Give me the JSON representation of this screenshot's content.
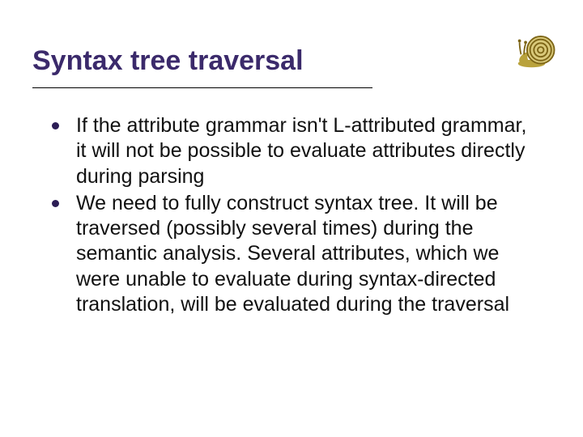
{
  "slide": {
    "title": "Syntax tree traversal",
    "bullets": [
      "If the attribute grammar isn't L-attributed grammar, it will not be possible to evaluate attributes directly during parsing",
      "We need to fully construct syntax tree. It will be traversed (possibly several times) during the semantic analysis. Several attributes, which we were unable to evaluate during syntax-directed translation, will be evaluated during the traversal"
    ]
  }
}
